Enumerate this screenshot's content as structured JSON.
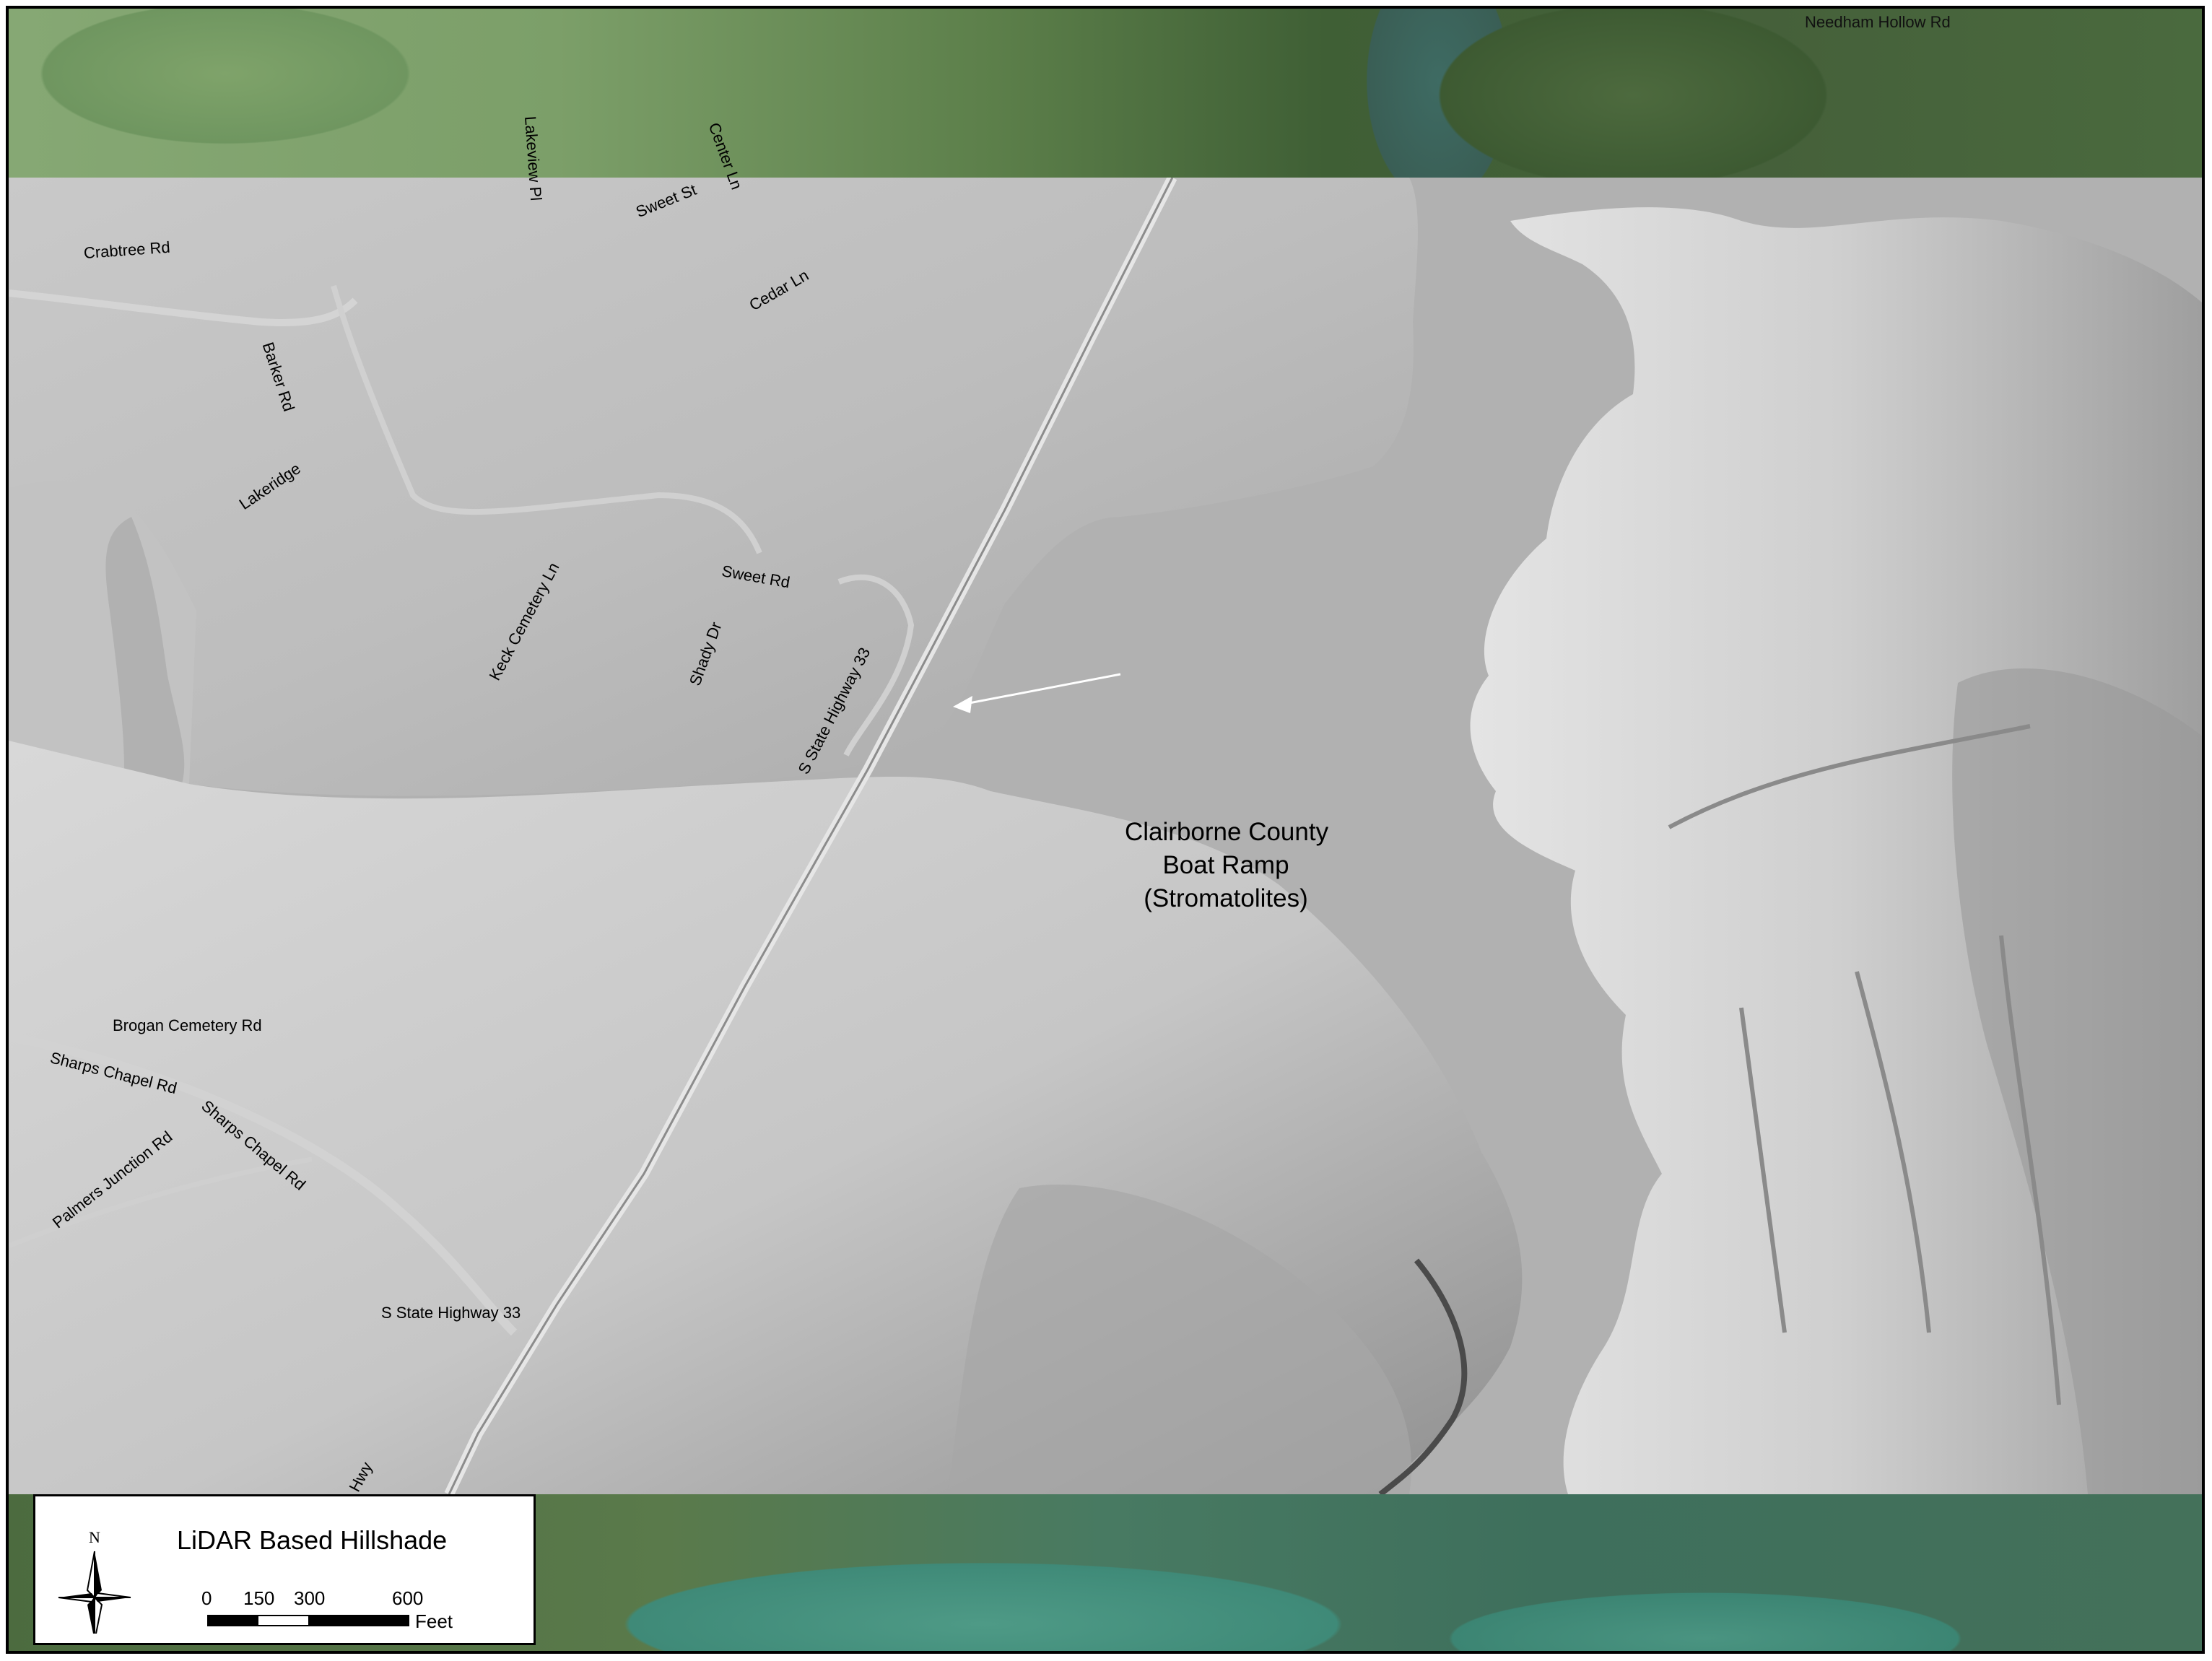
{
  "top_strip": {
    "road_labels": [
      "Needham Hollow Rd"
    ]
  },
  "callout": {
    "lines": [
      "Clairborne County",
      "Boat Ramp",
      "(Stromatolites)"
    ]
  },
  "road_labels": [
    "Lakeview Pl",
    "Center Ln",
    "Sweet St",
    "Crabtree Rd",
    "Cedar Ln",
    "Barker Rd",
    "Lakeridge",
    "Keck Cemetery Ln",
    "Sweet Rd",
    "Shady Dr",
    "S State Highway 33",
    "Brogan Cemetery Rd",
    "Sharps Chapel Rd",
    "Sharps Chapel Rd",
    "Palmers Junction Rd",
    "S State Highway 33",
    "Hwy"
  ],
  "legend": {
    "title": "LiDAR Based Hillshade",
    "north_label": "N",
    "scale_ticks": [
      "0",
      "150",
      "300",
      "600"
    ],
    "scale_unit": "Feet"
  },
  "colors": {
    "water": "#b1b1b1",
    "callout_arrow": "#ffffff",
    "scale_dark": "#000000",
    "scale_light": "#ffffff"
  },
  "icons": {
    "north_arrow": "north-arrow-icon"
  }
}
